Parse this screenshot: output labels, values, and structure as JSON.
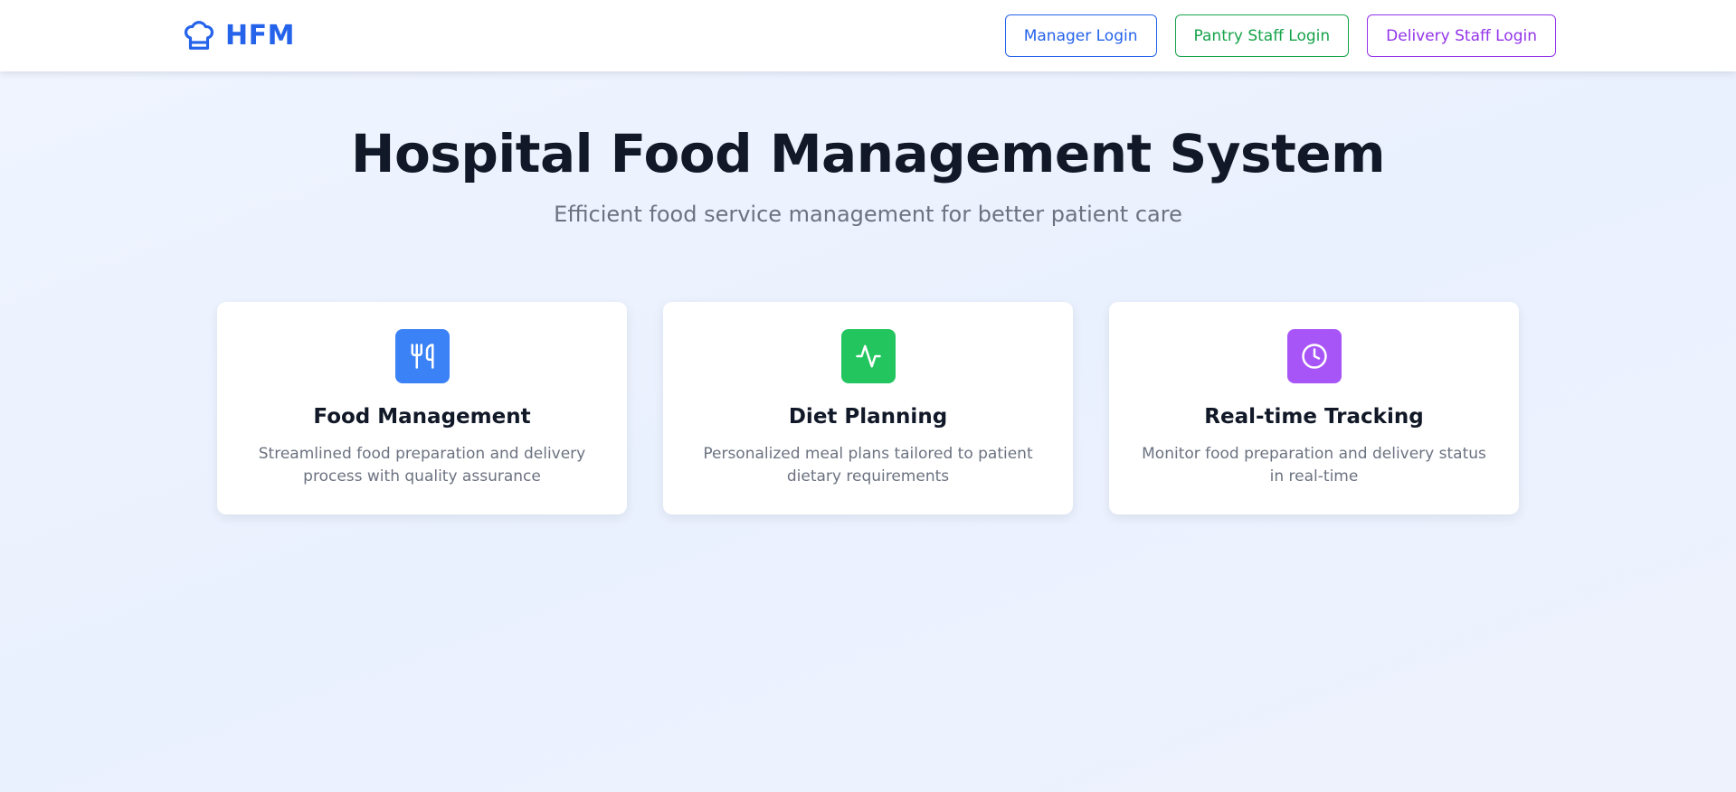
{
  "header": {
    "brand": "HFM",
    "brand_icon": "chef-hat-icon",
    "buttons": {
      "manager": "Manager Login",
      "pantry": "Pantry Staff Login",
      "delivery": "Delivery Staff Login"
    }
  },
  "hero": {
    "title": "Hospital Food Management System",
    "subtitle": "Efficient food service management for better patient care"
  },
  "features": [
    {
      "icon": "utensils-icon",
      "color": "#3b82f6",
      "title": "Food Management",
      "description": "Streamlined food preparation and delivery process with quality assurance"
    },
    {
      "icon": "activity-icon",
      "color": "#22c55e",
      "title": "Diet Planning",
      "description": "Personalized meal plans tailored to patient dietary requirements"
    },
    {
      "icon": "clock-icon",
      "color": "#a855f7",
      "title": "Real-time Tracking",
      "description": "Monitor food preparation and delivery status in real-time"
    }
  ],
  "colors": {
    "brand": "#2563eb",
    "manager": "#2563eb",
    "pantry": "#16a34a",
    "delivery": "#9333ea"
  }
}
